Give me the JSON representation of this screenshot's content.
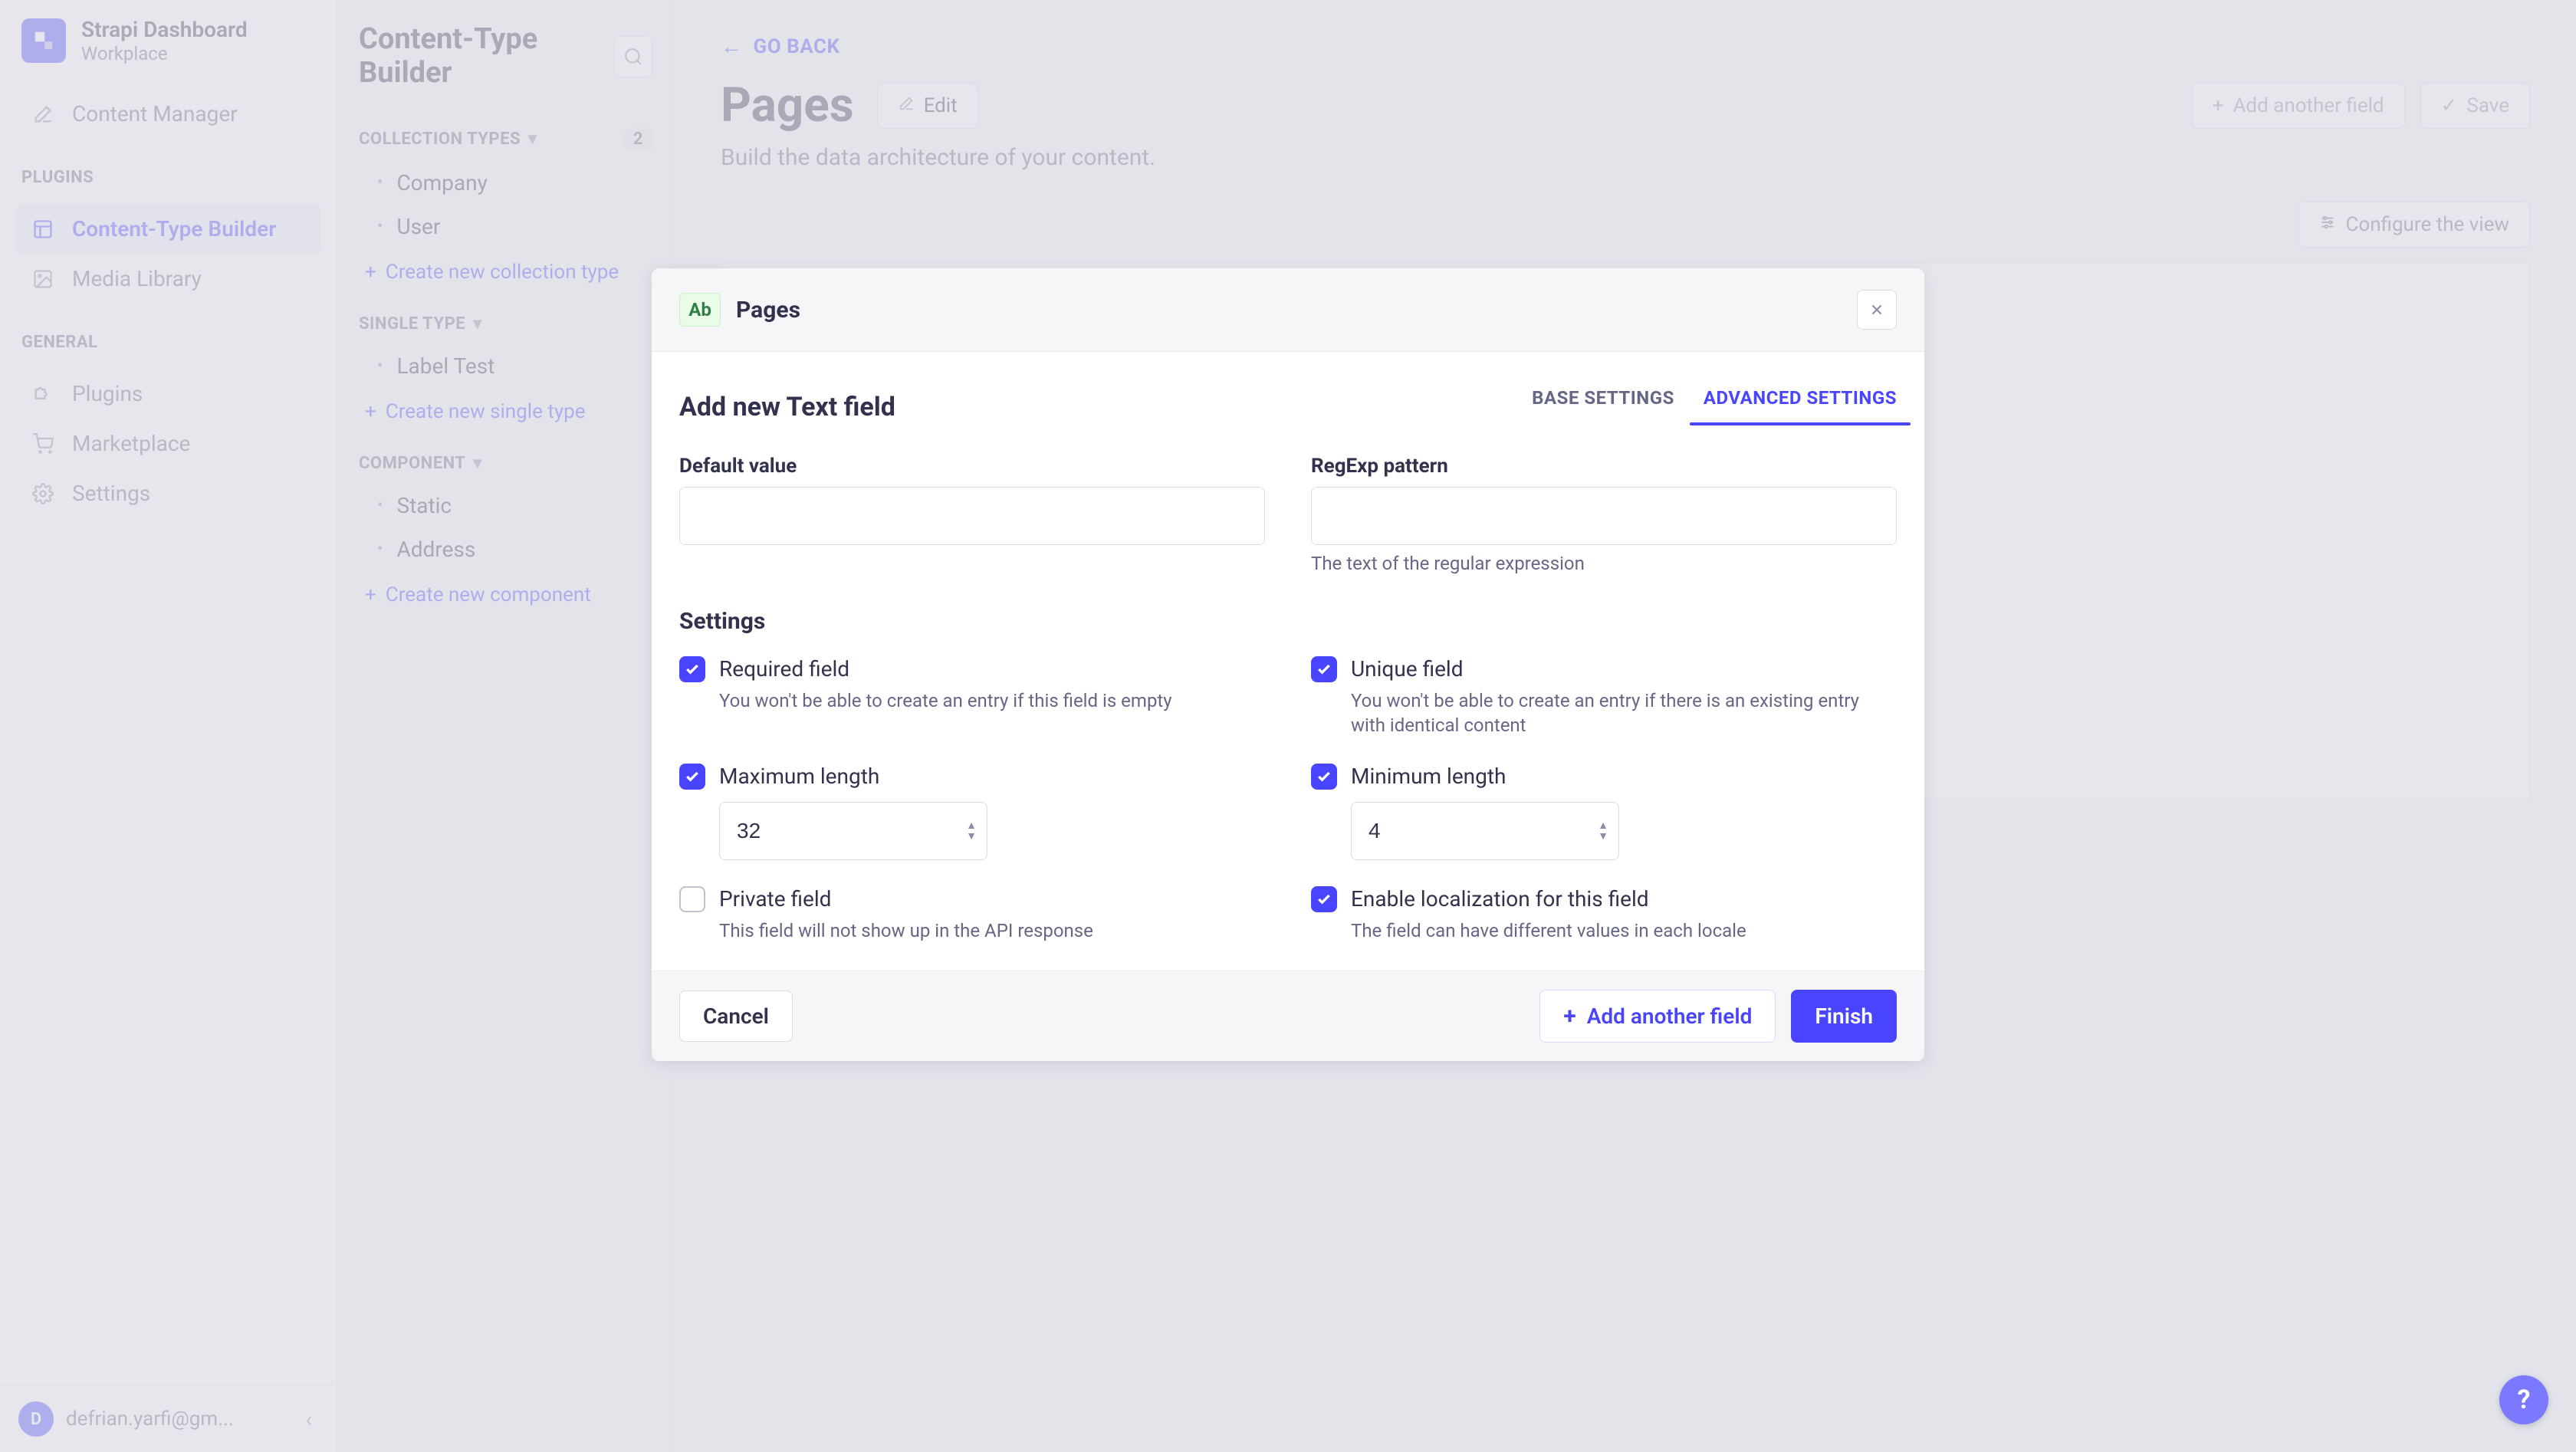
{
  "brand": {
    "title": "Strapi Dashboard",
    "subtitle": "Workplace"
  },
  "nav": {
    "items": [
      {
        "label": "Content Manager"
      }
    ],
    "plugins_heading": "PLUGINS",
    "plugins": [
      {
        "label": "Content-Type Builder",
        "active": true
      },
      {
        "label": "Media Library"
      }
    ],
    "general_heading": "GENERAL",
    "general": [
      {
        "label": "Plugins"
      },
      {
        "label": "Marketplace"
      },
      {
        "label": "Settings"
      }
    ]
  },
  "user": {
    "initial": "D",
    "email": "defrian.yarfi@gm..."
  },
  "sub": {
    "title": "Content-Type Builder",
    "groups": {
      "collection": {
        "heading": "COLLECTION TYPES",
        "count": "2",
        "items": [
          "Company",
          "User"
        ],
        "create": "Create new collection type"
      },
      "single": {
        "heading": "SINGLE TYPE",
        "items": [
          "Label Test"
        ],
        "create": "Create new single type"
      },
      "component": {
        "heading": "COMPONENT",
        "items": [
          "Static",
          "Address"
        ],
        "create": "Create new component"
      }
    }
  },
  "header": {
    "go_back": "GO BACK",
    "title": "Pages",
    "edit": "Edit",
    "subtitle": "Build the data architecture of your content.",
    "add_field": "Add another field",
    "save": "Save",
    "configure": "Configure the view"
  },
  "modal": {
    "badge": "Ab",
    "type_name": "Pages",
    "title": "Add new Text field",
    "tabs": {
      "base": "BASE SETTINGS",
      "advanced": "ADVANCED SETTINGS"
    },
    "fields": {
      "default_label": "Default value",
      "regexp_label": "RegExp pattern",
      "regexp_hint": "The text of the regular expression"
    },
    "settings_title": "Settings",
    "settings": {
      "required": {
        "label": "Required field",
        "desc": "You won't be able to create an entry if this field is empty"
      },
      "unique": {
        "label": "Unique field",
        "desc": "You won't be able to create an entry if there is an existing entry with identical content"
      },
      "maxlen": {
        "label": "Maximum length",
        "value": "32"
      },
      "minlen": {
        "label": "Minimum length",
        "value": "4"
      },
      "private": {
        "label": "Private field",
        "desc": "This field will not show up in the API response"
      },
      "localize": {
        "label": "Enable localization for this field",
        "desc": "The field can have different values in each locale"
      }
    },
    "footer": {
      "cancel": "Cancel",
      "add": "Add another field",
      "finish": "Finish"
    }
  },
  "help": "?"
}
